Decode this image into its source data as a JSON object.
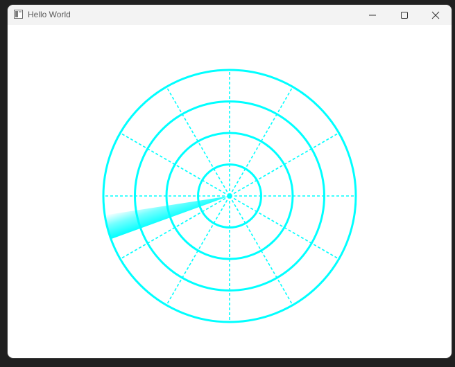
{
  "window": {
    "title": "Hello World",
    "controls": {
      "minimize": "minimize-icon",
      "maximize": "maximize-icon",
      "close": "close-icon"
    }
  },
  "radar": {
    "color": "#00ffff",
    "ring_count": 4,
    "spoke_count": 12,
    "sweep_angle_deg": 200
  }
}
